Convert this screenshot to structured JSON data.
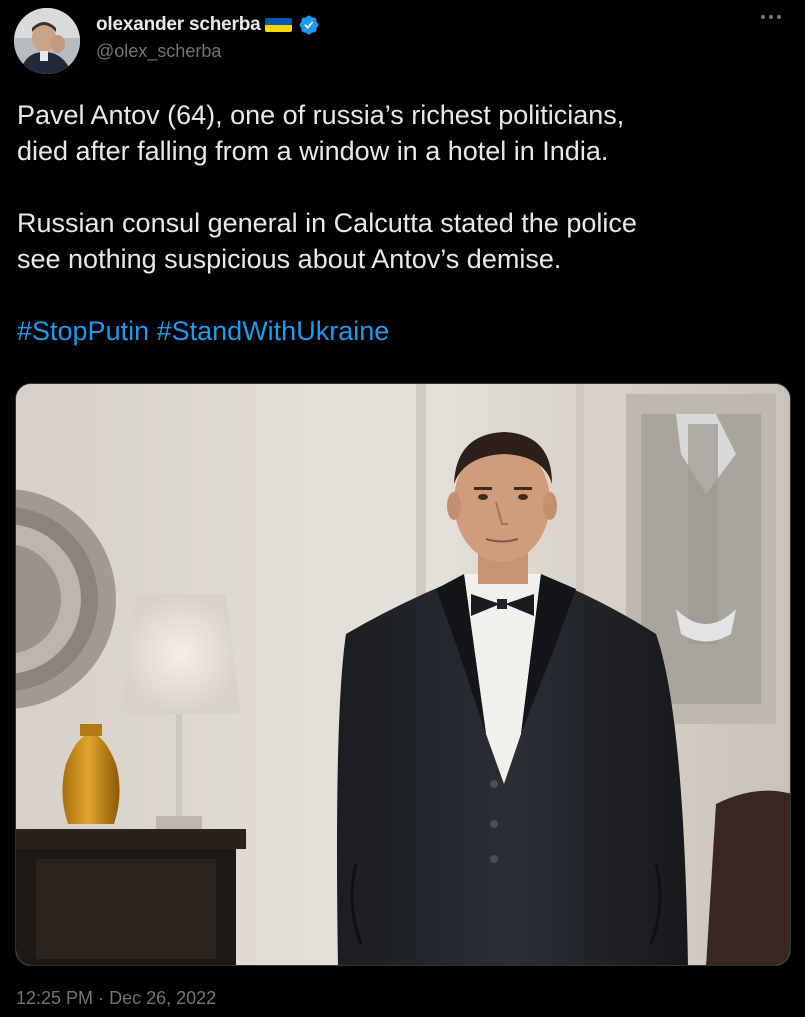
{
  "author": {
    "display_name": "olexander scherba",
    "handle": "@olex_scherba",
    "flag_icon": "ukraine-flag-icon",
    "verified_icon": "verified-badge-icon",
    "colors": {
      "flag_blue": "#0057b7",
      "flag_yellow": "#ffd700",
      "verified": "#1d9bf0"
    }
  },
  "tweet": {
    "paragraph_1": "Pavel Antov (64), one of russia’s richest politicians, died after falling from a window in a hotel in India.",
    "paragraph_1_line_1": "Pavel Antov (64), one of russia’s richest politicians,",
    "paragraph_1_line_2": "died after falling from a window in a hotel in India.",
    "paragraph_2_line_1": "Russian consul general in Calcutta stated the police",
    "paragraph_2_line_2": "see nothing suspicious about Antov’s demise.",
    "hashtags": [
      "#StopPutin",
      "#StandWithUkraine"
    ]
  },
  "media": {
    "type": "photo"
  },
  "meta": {
    "time": "12:25 PM",
    "separator": "·",
    "date": "Dec 26, 2022"
  },
  "theme": {
    "background": "#000000",
    "text": "#e7e9ea",
    "secondary_text": "#71767b",
    "link": "#1d9bf0"
  }
}
